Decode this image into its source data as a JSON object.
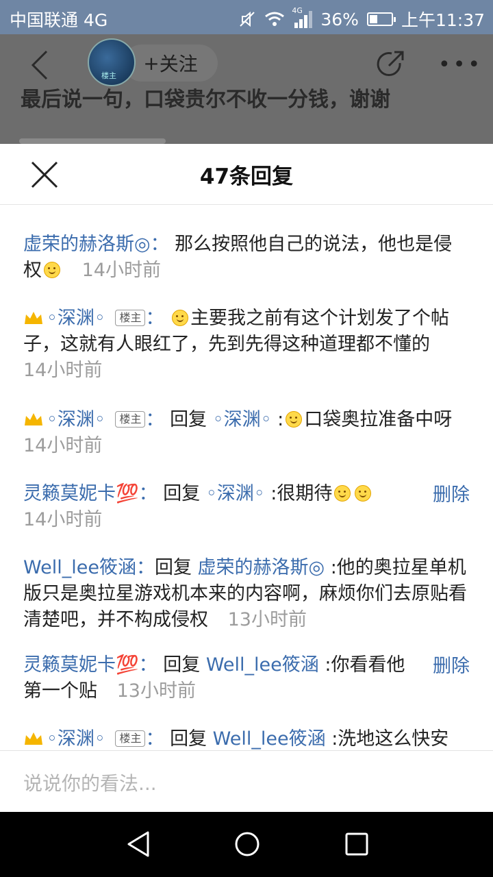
{
  "status_bar": {
    "carrier": "中国联通 4G",
    "network_badge": "4G",
    "battery_percent": "36%",
    "battery_level": 0.36,
    "time": "上午11:37",
    "icons": [
      "mute-icon",
      "wifi-icon",
      "signal-icon",
      "battery-icon"
    ]
  },
  "background_page": {
    "follow_label": "关注",
    "follow_plus": "+",
    "avatar_badge": "楼主",
    "behind_text": "最后说一句，口袋贵尔不收一分钱，谢谢"
  },
  "sheet": {
    "title": "47条回复"
  },
  "replies": [
    {
      "user": "虚荣的赫洛斯◎",
      "sep": "：",
      "text": "那么按照他自己的说法，他也是侵权",
      "time": "14小时前"
    },
    {
      "user": "◦深渊◦",
      "badge": "楼主",
      "sep": "：",
      "text": "主要我之前有这个计划发了个帖子，这就有人眼红了，先到先得这种道理都不懂的",
      "time": "14小时前"
    },
    {
      "user": "◦深渊◦",
      "badge": "楼主",
      "sep": "：",
      "reply_word": "回复",
      "target": "◦深渊◦",
      "text": ":",
      "text2": "口袋奥拉准备中呀",
      "time": "14小时前"
    },
    {
      "user": "灵籁莫妮卡💯",
      "sep": "：",
      "reply_word": "回复",
      "target": "◦深渊◦",
      "text": ":很期待",
      "time": "14小时前",
      "delete_label": "删除"
    },
    {
      "user": "Well_lee筱涵",
      "sep": "：",
      "reply_word": "回复",
      "target": "虚荣的赫洛斯◎",
      "text": ":他的奥拉星单机版只是奥拉星游戏机本来的内容啊，麻烦你们去原贴看清楚吧，并不构成侵权",
      "time": "13小时前"
    },
    {
      "user": "灵籁莫妮卡💯",
      "sep": "：",
      "reply_word": "回复",
      "target": "Well_lee筱涵",
      "text": ":你看看他第一个贴",
      "time": "13小时前",
      "delete_label": "删除"
    },
    {
      "user": "◦深渊◦",
      "badge": "楼主",
      "sep": "：",
      "reply_word": "回复",
      "target": "Well_lee筱涵",
      "text": ":洗地这么快安"
    }
  ],
  "input": {
    "placeholder": "说说你的看法..."
  }
}
